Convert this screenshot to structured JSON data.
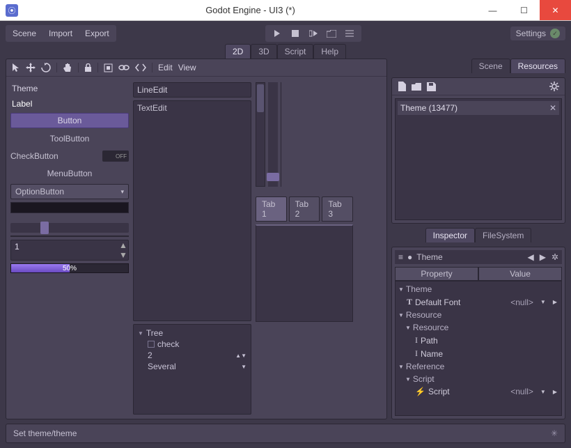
{
  "window": {
    "title": "Godot Engine - UI3 (*)"
  },
  "menubar": {
    "scene": "Scene",
    "import": "Import",
    "export": "Export",
    "settings": "Settings"
  },
  "worktabs": {
    "t2d": "2D",
    "t3d": "3D",
    "script": "Script",
    "help": "Help"
  },
  "toolbar": {
    "edit": "Edit",
    "view": "View"
  },
  "theme_col": {
    "theme": "Theme",
    "label": "Label",
    "button": "Button",
    "toolbutton": "ToolButton",
    "checkbutton": "CheckButton",
    "toggle_off": "OFF",
    "menubutton": "MenuButton",
    "optionbutton": "OptionButton",
    "spin_val": "1",
    "progress_label": "50%"
  },
  "mid_col": {
    "lineedit": "LineEdit",
    "textedit": "TextEdit",
    "tree": {
      "root": "Tree",
      "check": "check",
      "two": "2",
      "several": "Several"
    }
  },
  "tabs": {
    "t1": "Tab 1",
    "t2": "Tab 2",
    "t3": "Tab 3"
  },
  "right_tabs": {
    "scene": "Scene",
    "resources": "Resources"
  },
  "scene_item": "Theme (13477)",
  "bottom_tabs": {
    "inspector": "Inspector",
    "filesystem": "FileSystem"
  },
  "inspector": {
    "object": "Theme",
    "col_property": "Property",
    "col_value": "Value",
    "sec_theme": "Theme",
    "default_font": "Default Font",
    "null": "<null>",
    "sec_resource": "Resource",
    "sub_resource": "Resource",
    "path": "Path",
    "name": "Name",
    "sec_reference": "Reference",
    "sub_script": "Script",
    "script": "Script"
  },
  "status": "Set theme/theme"
}
